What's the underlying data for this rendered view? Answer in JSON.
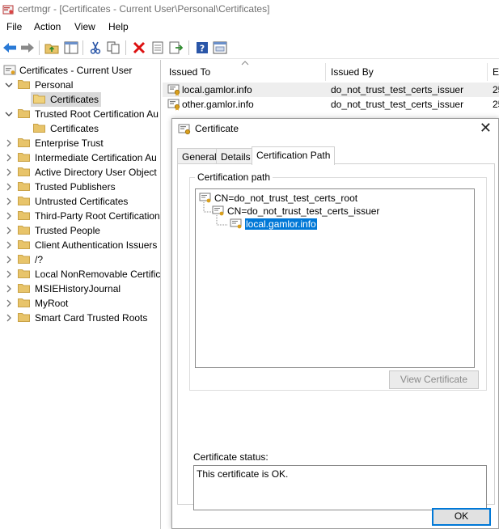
{
  "window": {
    "title": "certmgr - [Certificates - Current User\\Personal\\Certificates]"
  },
  "menu": {
    "items": [
      "File",
      "Action",
      "View",
      "Help"
    ]
  },
  "toolbar": {
    "buttons": [
      "back-icon",
      "forward-icon",
      "up-folder-icon",
      "show-hide-tree-icon",
      "cut-icon",
      "copy-icon",
      "delete-icon",
      "properties-icon",
      "export-icon",
      "help-icon",
      "console-icon"
    ]
  },
  "tree": {
    "root": "Certificates - Current User",
    "items": [
      {
        "label": "Personal"
      },
      {
        "label": "Certificates"
      },
      {
        "label": "Trusted Root Certification Au"
      },
      {
        "label": "Certificates"
      },
      {
        "label": "Enterprise Trust"
      },
      {
        "label": "Intermediate Certification Au"
      },
      {
        "label": "Active Directory User Object"
      },
      {
        "label": "Trusted Publishers"
      },
      {
        "label": "Untrusted Certificates"
      },
      {
        "label": "Third-Party Root Certification"
      },
      {
        "label": "Trusted People"
      },
      {
        "label": "Client Authentication Issuers"
      },
      {
        "label": "/?"
      },
      {
        "label": "Local NonRemovable Certific"
      },
      {
        "label": "MSIEHistoryJournal"
      },
      {
        "label": "MyRoot"
      },
      {
        "label": "Smart Card Trusted Roots"
      }
    ]
  },
  "list": {
    "columns": [
      "Issued To",
      "Issued By",
      "Ex"
    ],
    "rows": [
      {
        "issued_to": "local.gamlor.info",
        "issued_by": "do_not_trust_test_certs_issuer",
        "exp": "25"
      },
      {
        "issued_to": "other.gamlor.info",
        "issued_by": "do_not_trust_test_certs_issuer",
        "exp": "25"
      }
    ]
  },
  "dialog": {
    "title": "Certificate",
    "close": "✕",
    "tabs": [
      "General",
      "Details",
      "Certification Path"
    ],
    "active_tab": "Certification Path",
    "path_group_label": "Certification path",
    "path": [
      "CN=do_not_trust_test_certs_root",
      "CN=do_not_trust_test_certs_issuer",
      "local.gamlor.info"
    ],
    "view_button": "View Certificate",
    "status_label": "Certificate status:",
    "status_text": "This certificate is OK.",
    "ok_button": "OK"
  },
  "colors": {
    "selection": "#0078d7",
    "folder": "#e8c46a"
  }
}
